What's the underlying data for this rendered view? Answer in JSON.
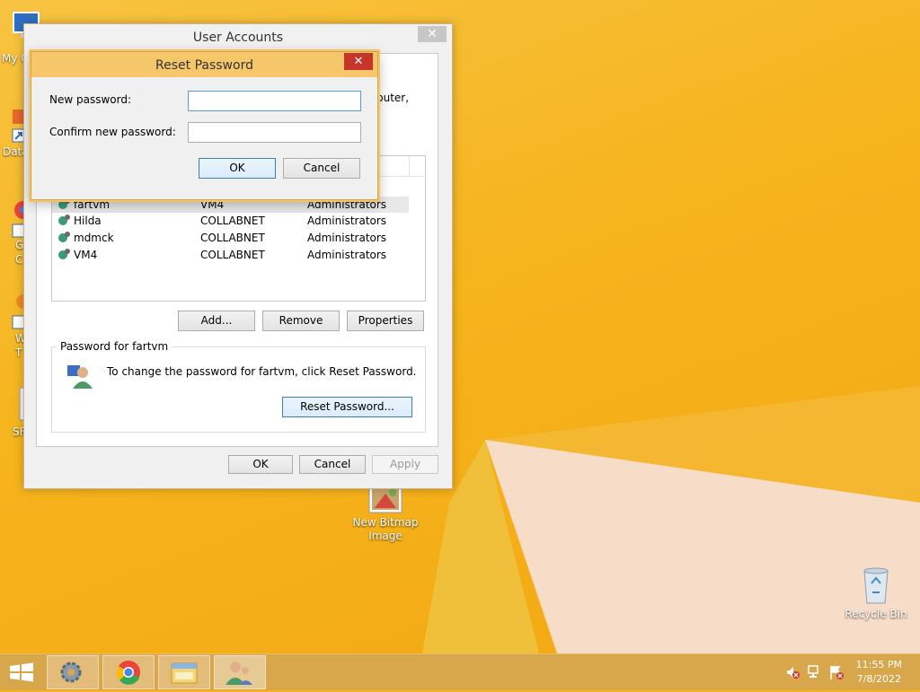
{
  "desktop": {
    "icons": [
      {
        "label": "My C",
        "name": "my-computer"
      },
      {
        "label": "Data",
        "name": "data"
      },
      {
        "label": "G",
        "label2": "C",
        "name": "google-chrome"
      },
      {
        "label": "W",
        "label2": "T",
        "name": "w-shortcut"
      },
      {
        "label": "SF",
        "name": "sf-shortcut"
      }
    ],
    "bitmap_label": "New Bitmap Image",
    "recycle_label": "Recycle Bin"
  },
  "user_accounts": {
    "title": "User Accounts",
    "intro_fragment": "puter,",
    "users": [
      {
        "name": "fartvm",
        "domain": "VM4",
        "group": "Administrators"
      },
      {
        "name": "Hilda",
        "domain": "COLLABNET",
        "group": "Administrators"
      },
      {
        "name": "mdmck",
        "domain": "COLLABNET",
        "group": "Administrators"
      },
      {
        "name": "VM4",
        "domain": "COLLABNET",
        "group": "Administrators"
      }
    ],
    "add_label": "Add...",
    "remove_label": "Remove",
    "properties_label": "Properties",
    "password_group": "Password for fartvm",
    "password_text": "To change the password for fartvm, click Reset Password.",
    "reset_label": "Reset Password...",
    "ok_label": "OK",
    "cancel_label": "Cancel",
    "apply_label": "Apply"
  },
  "reset_dialog": {
    "title": "Reset Password",
    "new_password_label": "New password:",
    "confirm_label": "Confirm new password:",
    "new_password_value": "",
    "confirm_value": "",
    "ok_label": "OK",
    "cancel_label": "Cancel"
  },
  "taskbar": {
    "time": "11:55 PM",
    "date": "7/8/2022"
  }
}
